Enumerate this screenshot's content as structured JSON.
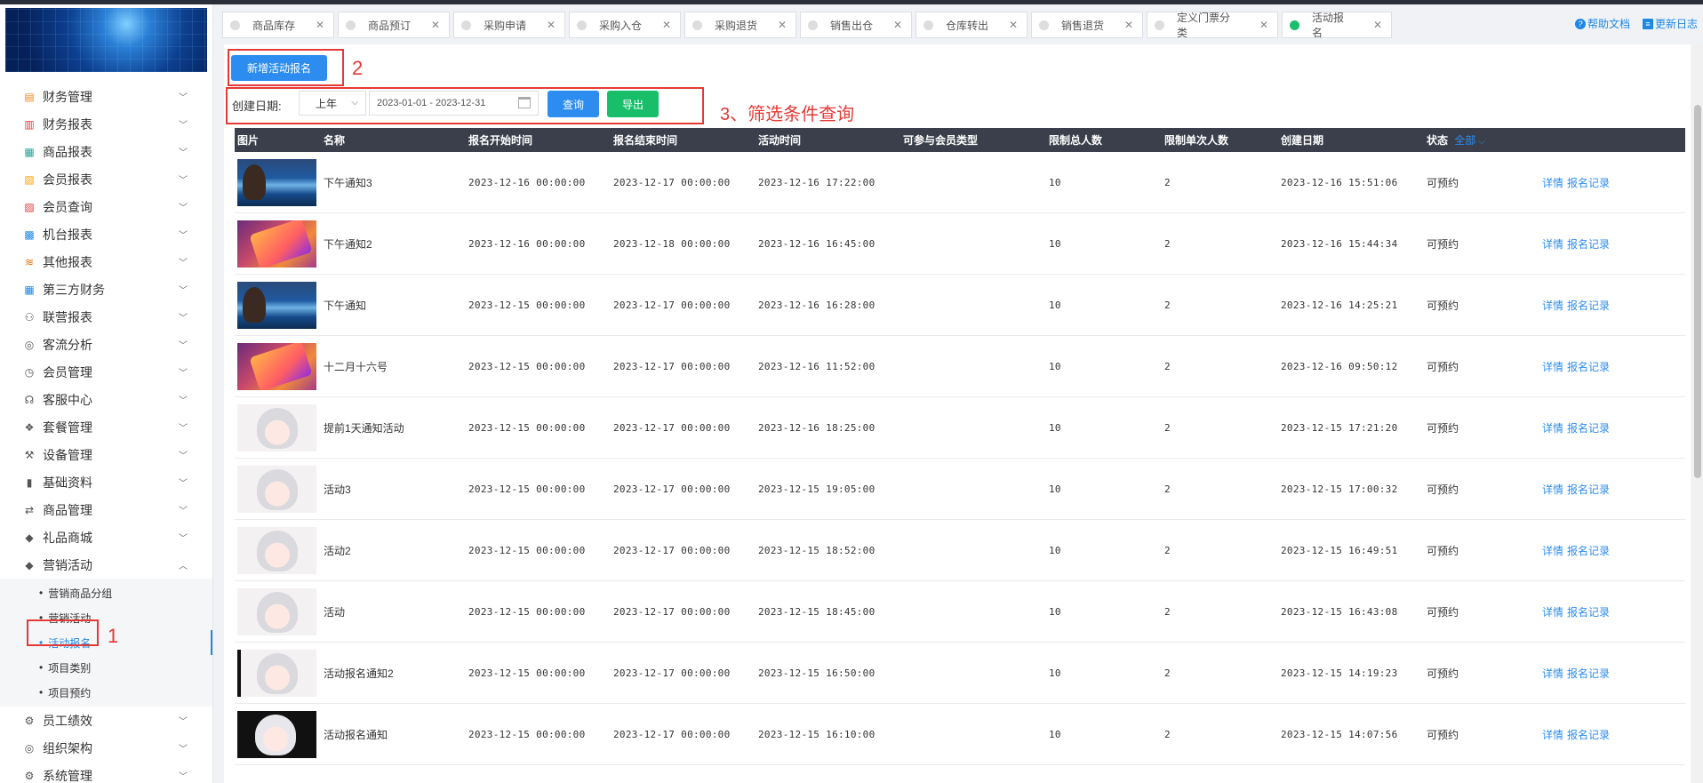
{
  "sidebar": {
    "menu": [
      {
        "label": "财务管理",
        "icon": "finance-icon",
        "color": "#f5871f"
      },
      {
        "label": "财务报表",
        "icon": "report-icon",
        "color": "#e53935"
      },
      {
        "label": "商品报表",
        "icon": "goods-report-icon",
        "color": "#26a69a"
      },
      {
        "label": "会员报表",
        "icon": "member-report-icon",
        "color": "#ffa000"
      },
      {
        "label": "会员查询",
        "icon": "member-query-icon",
        "color": "#e53935"
      },
      {
        "label": "机台报表",
        "icon": "machine-report-icon",
        "color": "#1e88e5"
      },
      {
        "label": "其他报表",
        "icon": "layers-icon",
        "color": "#ef6c00"
      },
      {
        "label": "第三方财务",
        "icon": "calculator-icon",
        "color": "#1e88e5"
      },
      {
        "label": "联营报表",
        "icon": "users-icon",
        "color": "#555555"
      },
      {
        "label": "客流分析",
        "icon": "target-icon",
        "color": "#555555"
      },
      {
        "label": "会员管理",
        "icon": "clock-icon",
        "color": "#555555"
      },
      {
        "label": "客服中心",
        "icon": "headset-icon",
        "color": "#555555"
      },
      {
        "label": "套餐管理",
        "icon": "package-icon",
        "color": "#555555"
      },
      {
        "label": "设备管理",
        "icon": "wrench-icon",
        "color": "#555555"
      },
      {
        "label": "基础资料",
        "icon": "document-icon",
        "color": "#555555"
      },
      {
        "label": "商品管理",
        "icon": "swap-icon",
        "color": "#555555"
      },
      {
        "label": "礼品商城",
        "icon": "tag-icon",
        "color": "#555555"
      },
      {
        "label": "营销活动",
        "icon": "tag-icon",
        "color": "#555555"
      }
    ],
    "submenu": [
      {
        "label": "营销商品分组"
      },
      {
        "label": "营销活动"
      },
      {
        "label": "活动报名"
      },
      {
        "label": "项目类别"
      },
      {
        "label": "项目预约"
      }
    ],
    "menu_after": [
      {
        "label": "员工绩效",
        "icon": "gear-icon"
      },
      {
        "label": "组织架构",
        "icon": "target-icon"
      },
      {
        "label": "系统管理",
        "icon": "gear-icon"
      }
    ]
  },
  "tabs": [
    {
      "label": "商品库存"
    },
    {
      "label": "商品预订"
    },
    {
      "label": "采购申请"
    },
    {
      "label": "采购入仓"
    },
    {
      "label": "采购退货"
    },
    {
      "label": "销售出仓"
    },
    {
      "label": "仓库转出"
    },
    {
      "label": "销售退货"
    },
    {
      "label": "定义门票分类"
    },
    {
      "label": "活动报名"
    }
  ],
  "help": {
    "docs": "帮助文档",
    "changelog": "更新日志"
  },
  "toolbar": {
    "add_label": "新增活动报名"
  },
  "filter": {
    "label": "创建日期:",
    "period": "上年",
    "date_range": "2023-01-01 - 2023-12-31",
    "query_label": "查询",
    "export_label": "导出"
  },
  "annotations": {
    "one": "1",
    "two": "2",
    "three": "3、筛选条件查询"
  },
  "table": {
    "headers": {
      "image": "图片",
      "name": "名称",
      "start": "报名开始时间",
      "end": "报名结束时间",
      "time": "活动时间",
      "member_type": "可参与会员类型",
      "total": "限制总人数",
      "single": "限制单次人数",
      "created": "创建日期",
      "status": "状态",
      "status_filter": "全部"
    },
    "rows": [
      {
        "thumb": "ocean",
        "name": "下午通知3",
        "start": "2023-12-16 00:00:00",
        "end": "2023-12-17 00:00:00",
        "time": "2023-12-16 17:22:00",
        "member_type": "",
        "total": "10",
        "single": "2",
        "created": "2023-12-16 15:51:06",
        "status": "可预约",
        "detail": "详情",
        "records": "报名记录"
      },
      {
        "thumb": "phone",
        "name": "下午通知2",
        "start": "2023-12-16 00:00:00",
        "end": "2023-12-18 00:00:00",
        "time": "2023-12-16 16:45:00",
        "member_type": "",
        "total": "10",
        "single": "2",
        "created": "2023-12-16 15:44:34",
        "status": "可预约",
        "detail": "详情",
        "records": "报名记录"
      },
      {
        "thumb": "ocean",
        "name": "下午通知",
        "start": "2023-12-15 00:00:00",
        "end": "2023-12-17 00:00:00",
        "time": "2023-12-16 16:28:00",
        "member_type": "",
        "total": "10",
        "single": "2",
        "created": "2023-12-16 14:25:21",
        "status": "可预约",
        "detail": "详情",
        "records": "报名记录"
      },
      {
        "thumb": "phone",
        "name": "十二月十六号",
        "start": "2023-12-15 00:00:00",
        "end": "2023-12-17 00:00:00",
        "time": "2023-12-16 11:52:00",
        "member_type": "",
        "total": "10",
        "single": "2",
        "created": "2023-12-16 09:50:12",
        "status": "可预约",
        "detail": "详情",
        "records": "报名记录"
      },
      {
        "thumb": "girl",
        "name": "提前1天通知活动",
        "start": "2023-12-15 00:00:00",
        "end": "2023-12-17 00:00:00",
        "time": "2023-12-16 18:25:00",
        "member_type": "",
        "total": "10",
        "single": "2",
        "created": "2023-12-15 17:21:20",
        "status": "可预约",
        "detail": "详情",
        "records": "报名记录"
      },
      {
        "thumb": "girl",
        "name": "活动3",
        "start": "2023-12-15 00:00:00",
        "end": "2023-12-17 00:00:00",
        "time": "2023-12-15 19:05:00",
        "member_type": "",
        "total": "10",
        "single": "2",
        "created": "2023-12-15 17:00:32",
        "status": "可预约",
        "detail": "详情",
        "records": "报名记录"
      },
      {
        "thumb": "girl",
        "name": "活动2",
        "start": "2023-12-15 00:00:00",
        "end": "2023-12-17 00:00:00",
        "time": "2023-12-15 18:52:00",
        "member_type": "",
        "total": "10",
        "single": "2",
        "created": "2023-12-15 16:49:51",
        "status": "可预约",
        "detail": "详情",
        "records": "报名记录"
      },
      {
        "thumb": "girl",
        "name": "活动",
        "start": "2023-12-15 00:00:00",
        "end": "2023-12-17 00:00:00",
        "time": "2023-12-15 18:45:00",
        "member_type": "",
        "total": "10",
        "single": "2",
        "created": "2023-12-15 16:43:08",
        "status": "可预约",
        "detail": "详情",
        "records": "报名记录"
      },
      {
        "thumb": "girl-dark",
        "name": "活动报名通知2",
        "start": "2023-12-15 00:00:00",
        "end": "2023-12-17 00:00:00",
        "time": "2023-12-15 16:50:00",
        "member_type": "",
        "total": "10",
        "single": "2",
        "created": "2023-12-15 14:19:23",
        "status": "可预约",
        "detail": "详情",
        "records": "报名记录"
      },
      {
        "thumb": "girl-black",
        "name": "活动报名通知",
        "start": "2023-12-15 00:00:00",
        "end": "2023-12-17 00:00:00",
        "time": "2023-12-15 16:10:00",
        "member_type": "",
        "total": "10",
        "single": "2",
        "created": "2023-12-15 14:07:56",
        "status": "可预约",
        "detail": "详情",
        "records": "报名记录"
      }
    ]
  }
}
